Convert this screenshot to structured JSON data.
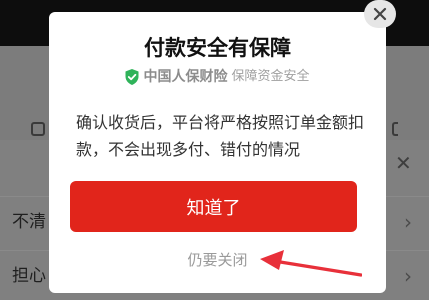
{
  "dialog": {
    "title": "付款安全有保障",
    "badge_brand": "中国人保财险",
    "badge_text": "保障资金安全",
    "body": "确认收货后，平台将严格按照订单金额扣款，不会出现多付、错付的情况",
    "confirm_label": "知道了",
    "secondary_label": "仍要关闭"
  },
  "background_rows": [
    {
      "label": "不清"
    },
    {
      "label": "担心"
    }
  ],
  "icons": {
    "close": "close-icon",
    "shield": "shield-check-icon",
    "sheet_close": "close-icon",
    "row_chevron": "chevron-right-icon"
  },
  "colors": {
    "accent": "#e1251b",
    "shield": "#2fb35a",
    "annotation": "#e8303a"
  }
}
